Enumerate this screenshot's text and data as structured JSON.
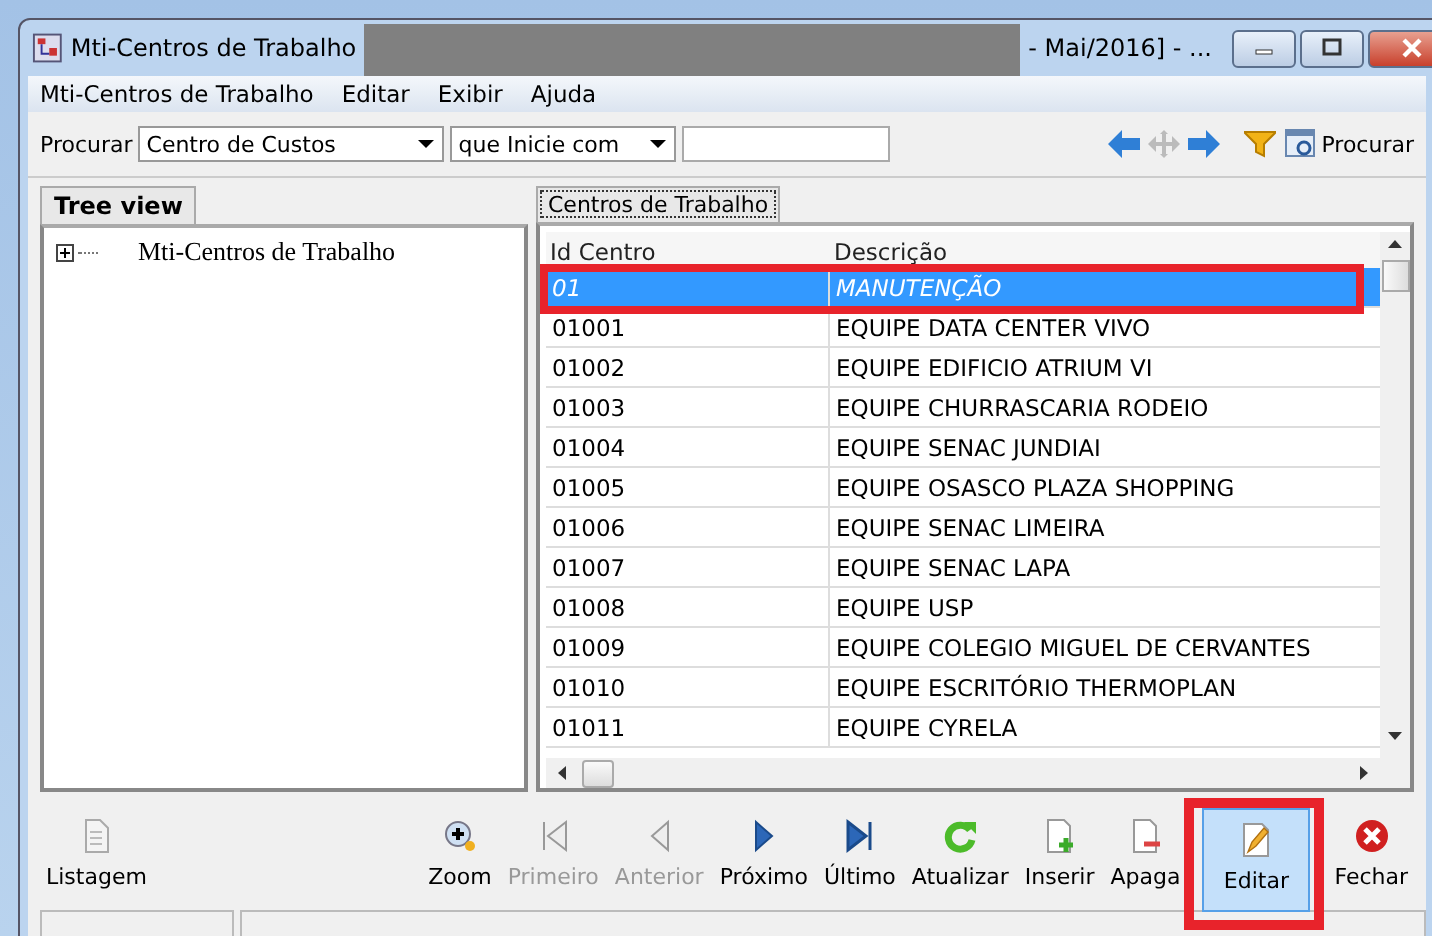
{
  "window": {
    "title_start": "Mti-Centros de Trabalho",
    "title_end": "- Mai/2016]  - ..."
  },
  "menu": [
    "Mti-Centros de Trabalho",
    "Editar",
    "Exibir",
    "Ajuda"
  ],
  "search": {
    "label": "Procurar",
    "field": "Centro de Custos",
    "mode": "que Inicie com",
    "find_button": "Procurar"
  },
  "tree": {
    "tab": "Tree view",
    "items": [
      {
        "label": "Mti-Centros de Trabalho",
        "expanded": false
      }
    ]
  },
  "grid": {
    "tab": "Centros de Trabalho",
    "columns": [
      "Id Centro",
      "Descrição"
    ],
    "rows": [
      {
        "id": "01",
        "desc": "MANUTENÇÃO",
        "selected": true
      },
      {
        "id": "01001",
        "desc": "EQUIPE DATA CENTER VIVO",
        "selected": false
      },
      {
        "id": "01002",
        "desc": "EQUIPE EDIFICIO ATRIUM VI",
        "selected": false
      },
      {
        "id": "01003",
        "desc": "EQUIPE CHURRASCARIA RODEIO",
        "selected": false
      },
      {
        "id": "01004",
        "desc": "EQUIPE SENAC JUNDIAI",
        "selected": false
      },
      {
        "id": "01005",
        "desc": "EQUIPE OSASCO PLAZA SHOPPING",
        "selected": false
      },
      {
        "id": "01006",
        "desc": "EQUIPE SENAC LIMEIRA",
        "selected": false
      },
      {
        "id": "01007",
        "desc": "EQUIPE SENAC LAPA",
        "selected": false
      },
      {
        "id": "01008",
        "desc": "EQUIPE USP",
        "selected": false
      },
      {
        "id": "01009",
        "desc": "EQUIPE COLEGIO MIGUEL DE CERVANTES",
        "selected": false
      },
      {
        "id": "01010",
        "desc": "EQUIPE ESCRITÓRIO THERMOPLAN",
        "selected": false
      },
      {
        "id": "01011",
        "desc": "EQUIPE CYRELA",
        "selected": false
      }
    ]
  },
  "actions": [
    {
      "kind": "list",
      "label": "Listagem",
      "disabled": false,
      "selected": false
    },
    {
      "kind": "zoom",
      "label": "Zoom",
      "disabled": false,
      "selected": false
    },
    {
      "kind": "first",
      "label": "Primeiro",
      "disabled": true,
      "selected": false
    },
    {
      "kind": "prev",
      "label": "Anterior",
      "disabled": true,
      "selected": false
    },
    {
      "kind": "next",
      "label": "Próximo",
      "disabled": false,
      "selected": false
    },
    {
      "kind": "last",
      "label": "Último",
      "disabled": false,
      "selected": false
    },
    {
      "kind": "refresh",
      "label": "Atualizar",
      "disabled": false,
      "selected": false
    },
    {
      "kind": "insert",
      "label": "Inserir",
      "disabled": false,
      "selected": false
    },
    {
      "kind": "delete",
      "label": "Apaga",
      "disabled": false,
      "selected": false
    },
    {
      "kind": "edit",
      "label": "Editar",
      "disabled": false,
      "selected": true
    },
    {
      "kind": "close",
      "label": "Fechar",
      "disabled": false,
      "selected": false
    }
  ]
}
